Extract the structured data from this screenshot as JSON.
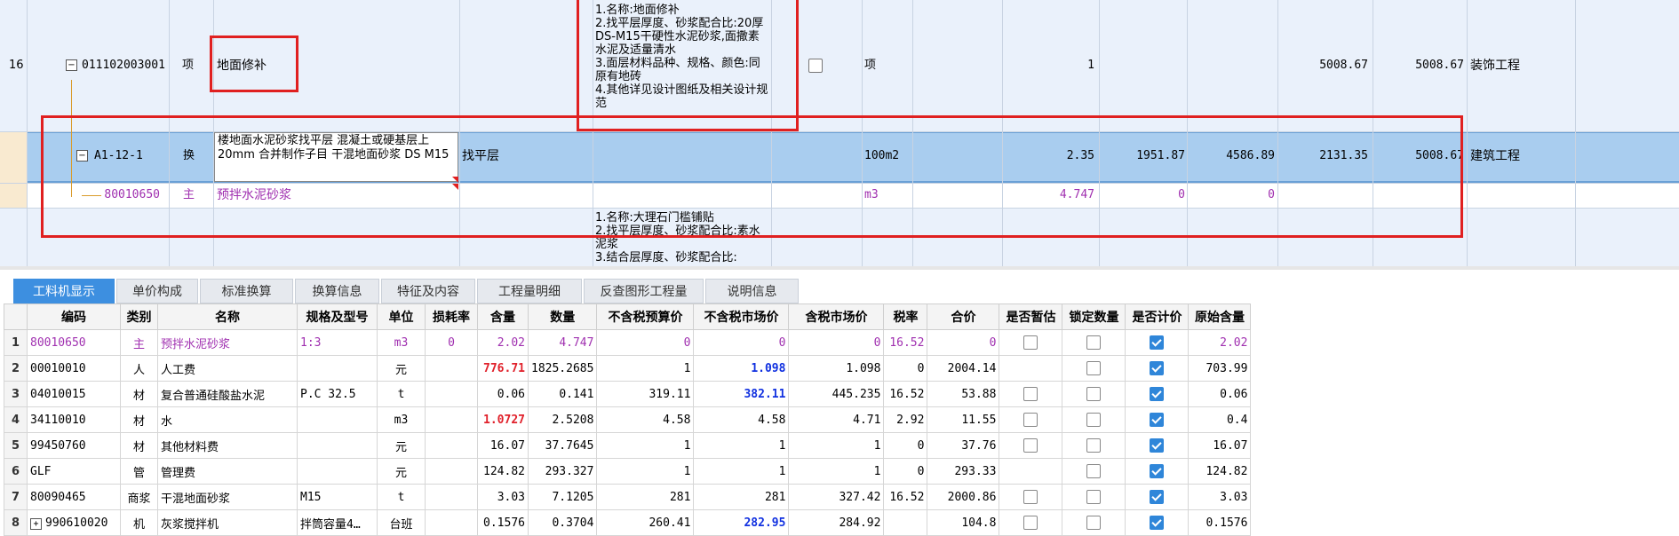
{
  "top_grid": {
    "row16": {
      "index": "16",
      "code": "011102003001",
      "type": "项",
      "name": "地面修补",
      "desc": "1.名称:地面修补\n2.找平层厚度、砂浆配合比:20厚DS-M15干硬性水泥砂浆,面撒素水泥及适量清水\n3.面层材料品种、规格、颜色:同原有地砖\n4.其他详见设计图纸及相关设计规范",
      "unit": "项",
      "qty": "1",
      "price": "5008.67",
      "total": "5008.67",
      "category": "装饰工程"
    },
    "rowA": {
      "code": "A1-12-1",
      "type": "换",
      "name": "楼地面水泥砂浆找平层 混凝土或硬基层上 20mm  合并制作子目 干混地面砂浆 DS M15",
      "feature": "找平层",
      "unit": "100m2",
      "qty": "2.35",
      "c1": "1951.87",
      "c2": "4586.89",
      "price": "2131.35",
      "total": "5008.67",
      "category": "建筑工程"
    },
    "rowB": {
      "code": "80010650",
      "type": "主",
      "name": "预拌水泥砂浆",
      "unit": "m3",
      "qty": "4.747",
      "c1": "0",
      "c2": "0"
    },
    "rowC": {
      "desc": "1.名称:大理石门槛铺贴\n2.找平层厚度、砂浆配合比:素水泥浆\n3.结合层厚度、砂浆配合比:"
    }
  },
  "tabs": [
    "工料机显示",
    "单价构成",
    "标准换算",
    "换算信息",
    "特征及内容",
    "工程量明细",
    "反查图形工程量",
    "说明信息"
  ],
  "table": {
    "headers": [
      "编码",
      "类别",
      "名称",
      "规格及型号",
      "单位",
      "损耗率",
      "含量",
      "数量",
      "不含税预算价",
      "不含税市场价",
      "含税市场价",
      "税率",
      "合价",
      "是否暂估",
      "锁定数量",
      "是否计价",
      "原始含量"
    ],
    "rows": [
      {
        "idx": "1",
        "code": "80010650",
        "cat": "主",
        "name": "预拌水泥砂浆",
        "spec": "1:3",
        "unit": "m3",
        "loss": "0",
        "content": "2.02",
        "qty": "4.747",
        "budget": "0",
        "market": "0",
        "taxmarket": "0",
        "rate": "16.52",
        "total": "0",
        "est": false,
        "lock": false,
        "priced": true,
        "orig": "2.02",
        "purple": true,
        "contentStyle": "",
        "marketStyle": ""
      },
      {
        "idx": "2",
        "code": "00010010",
        "cat": "人",
        "name": "人工费",
        "spec": "",
        "unit": "元",
        "loss": "",
        "content": "776.71",
        "qty": "1825.2685",
        "budget": "1",
        "market": "1.098",
        "taxmarket": "1.098",
        "rate": "0",
        "total": "2004.14",
        "est": null,
        "lock": false,
        "priced": true,
        "orig": "703.99",
        "purple": false,
        "contentStyle": "red",
        "marketStyle": "blue"
      },
      {
        "idx": "3",
        "code": "04010015",
        "cat": "材",
        "name": "复合普通硅酸盐水泥",
        "spec": "P.C 32.5",
        "unit": "t",
        "loss": "",
        "content": "0.06",
        "qty": "0.141",
        "budget": "319.11",
        "market": "382.11",
        "taxmarket": "445.235",
        "rate": "16.52",
        "total": "53.88",
        "est": false,
        "lock": false,
        "priced": true,
        "orig": "0.06",
        "purple": false,
        "contentStyle": "",
        "marketStyle": "blue"
      },
      {
        "idx": "4",
        "code": "34110010",
        "cat": "材",
        "name": "水",
        "spec": "",
        "unit": "m3",
        "loss": "",
        "content": "1.0727",
        "qty": "2.5208",
        "budget": "4.58",
        "market": "4.58",
        "taxmarket": "4.71",
        "rate": "2.92",
        "total": "11.55",
        "est": false,
        "lock": false,
        "priced": true,
        "orig": "0.4",
        "purple": false,
        "contentStyle": "red",
        "marketStyle": ""
      },
      {
        "idx": "5",
        "code": "99450760",
        "cat": "材",
        "name": "其他材料费",
        "spec": "",
        "unit": "元",
        "loss": "",
        "content": "16.07",
        "qty": "37.7645",
        "budget": "1",
        "market": "1",
        "taxmarket": "1",
        "rate": "0",
        "total": "37.76",
        "est": false,
        "lock": false,
        "priced": true,
        "orig": "16.07",
        "purple": false,
        "contentStyle": "",
        "marketStyle": ""
      },
      {
        "idx": "6",
        "code": "GLF",
        "cat": "管",
        "name": "管理费",
        "spec": "",
        "unit": "元",
        "loss": "",
        "content": "124.82",
        "qty": "293.327",
        "budget": "1",
        "market": "1",
        "taxmarket": "1",
        "rate": "0",
        "total": "293.33",
        "est": null,
        "lock": false,
        "priced": true,
        "orig": "124.82",
        "purple": false,
        "contentStyle": "",
        "marketStyle": ""
      },
      {
        "idx": "7",
        "code": "80090465",
        "cat": "商浆",
        "name": "干混地面砂浆",
        "spec": "M15",
        "unit": "t",
        "loss": "",
        "content": "3.03",
        "qty": "7.1205",
        "budget": "281",
        "market": "281",
        "taxmarket": "327.42",
        "rate": "16.52",
        "total": "2000.86",
        "est": false,
        "lock": false,
        "priced": true,
        "orig": "3.03",
        "purple": false,
        "contentStyle": "",
        "marketStyle": ""
      },
      {
        "idx": "8",
        "code": "990610020",
        "cat": "机",
        "name": "灰浆搅拌机",
        "spec": "拌筒容量4…",
        "unit": "台班",
        "loss": "",
        "content": "0.1576",
        "qty": "0.3704",
        "budget": "260.41",
        "market": "282.95",
        "taxmarket": "284.92",
        "rate": "",
        "total": "104.8",
        "est": false,
        "lock": false,
        "priced": true,
        "orig": "0.1576",
        "purple": false,
        "contentStyle": "",
        "marketStyle": "blue",
        "expander": "+"
      }
    ]
  }
}
